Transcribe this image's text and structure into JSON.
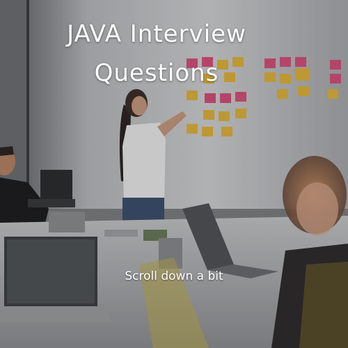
{
  "title": {
    "line1": "JAVA Interview",
    "line2": "Questions"
  },
  "hint": "Scroll down a bit",
  "colors": {
    "wall": "#d9dadb",
    "sticky_pink": "#d8507a",
    "sticky_yellow": "#e2b53a",
    "text": "#ffffff"
  }
}
